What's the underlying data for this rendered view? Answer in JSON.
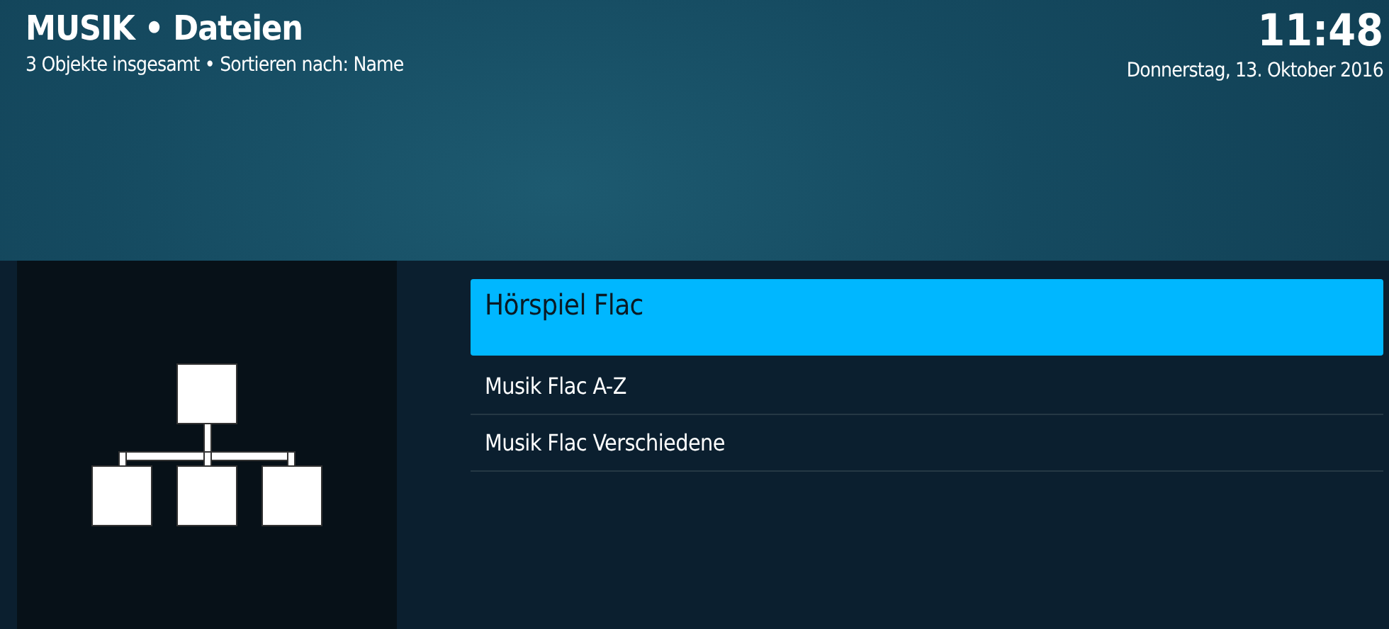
{
  "header": {
    "title": "MUSIK • Dateien",
    "subtitle": "3 Objekte insgesamt • Sortieren nach: Name",
    "time": "11:48",
    "date": "Donnerstag, 13. Oktober 2016"
  },
  "thumbnail": {
    "kind": "folder-tree"
  },
  "items": [
    {
      "label": "Hörspiel Flac",
      "selected": true
    },
    {
      "label": "Musik Flac A-Z",
      "selected": false
    },
    {
      "label": "Musik Flac Verschiedene",
      "selected": false
    }
  ]
}
